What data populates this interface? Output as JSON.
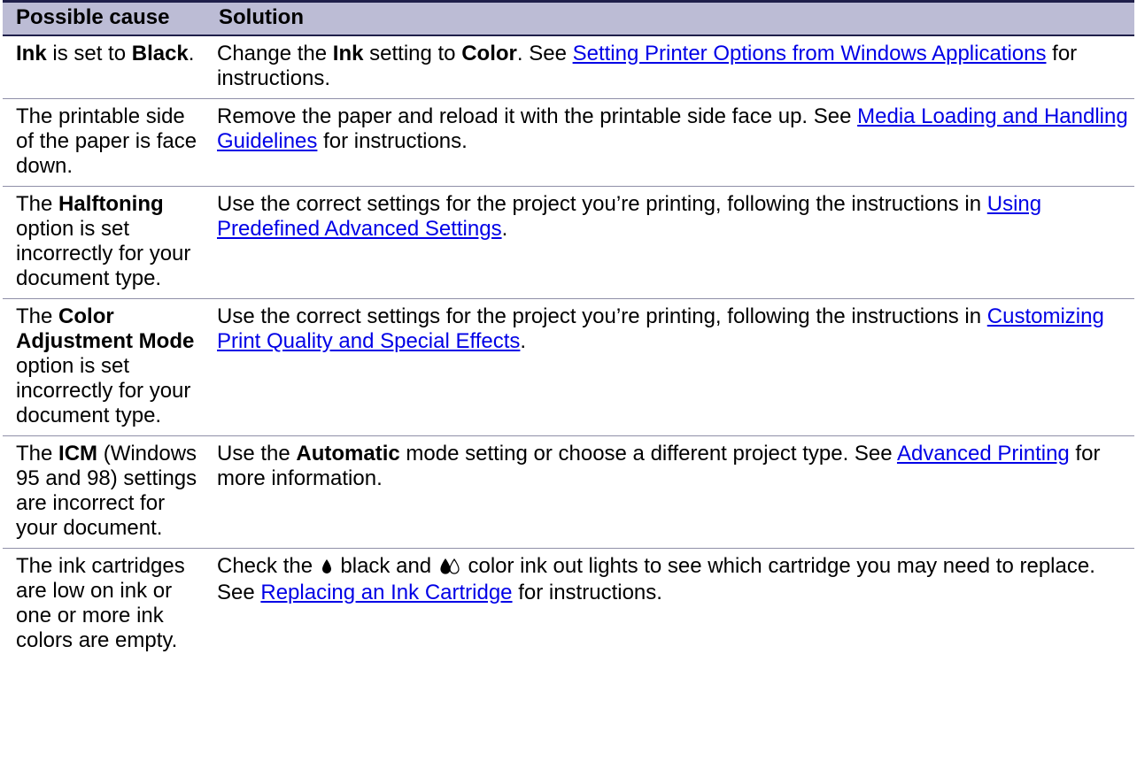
{
  "header": {
    "cause": "Possible cause",
    "solution": "Solution"
  },
  "rows": [
    {
      "cause": [
        {
          "t": "Ink",
          "b": 1
        },
        {
          "t": " is set to "
        },
        {
          "t": "Black",
          "b": 1
        },
        {
          "t": "."
        }
      ],
      "solution": [
        {
          "t": "Change the "
        },
        {
          "t": "Ink",
          "b": 1
        },
        {
          "t": " setting to "
        },
        {
          "t": "Color",
          "b": 1
        },
        {
          "t": ". See "
        },
        {
          "t": "Setting Printer Options from Windows Applications",
          "link": 1
        },
        {
          "t": " for instructions."
        }
      ]
    },
    {
      "cause": [
        {
          "t": "The printable side of the paper is face down."
        }
      ],
      "solution": [
        {
          "t": "Remove the paper and reload it with the printable side face up. See "
        },
        {
          "t": "Media Loading and Handling Guidelines",
          "link": 1
        },
        {
          "t": " for instructions."
        }
      ]
    },
    {
      "cause": [
        {
          "t": "The "
        },
        {
          "t": "Halftoning",
          "b": 1
        },
        {
          "t": " option is set incorrectly for your document type."
        }
      ],
      "solution": [
        {
          "t": "Use the correct settings for the project you’re printing, following the instructions in "
        },
        {
          "t": "Using Predefined Advanced Settings",
          "link": 1
        },
        {
          "t": "."
        }
      ]
    },
    {
      "cause": [
        {
          "t": "The "
        },
        {
          "t": "Color Adjustment Mode",
          "b": 1
        },
        {
          "t": " option is set incorrectly for your document type."
        }
      ],
      "solution": [
        {
          "t": "Use the correct settings for the project you’re printing, following the instructions in "
        },
        {
          "t": "Customizing Print Quality and Special Effects",
          "link": 1
        },
        {
          "t": "."
        }
      ]
    },
    {
      "cause": [
        {
          "t": "The "
        },
        {
          "t": "ICM",
          "b": 1
        },
        {
          "t": " (Windows 95 and 98) settings are incorrect for your document."
        }
      ],
      "solution": [
        {
          "t": "Use the "
        },
        {
          "t": "Automatic",
          "b": 1
        },
        {
          "t": " mode setting or choose a different project type. See "
        },
        {
          "t": "Advanced Printing",
          "link": 1
        },
        {
          "t": " for more information."
        }
      ]
    },
    {
      "cause": [
        {
          "t": "The ink cartridges are low on ink or one or more ink colors are empty."
        }
      ],
      "solution": [
        {
          "t": "Check the "
        },
        {
          "icon": "black-ink-drop-icon"
        },
        {
          "t": " black and "
        },
        {
          "icon": "color-ink-drops-icon"
        },
        {
          "t": " color ink out lights to see which cartridge you may need to replace. See "
        },
        {
          "t": "Replacing an Ink Cartridge",
          "link": 1
        },
        {
          "t": " for instructions."
        }
      ]
    }
  ]
}
